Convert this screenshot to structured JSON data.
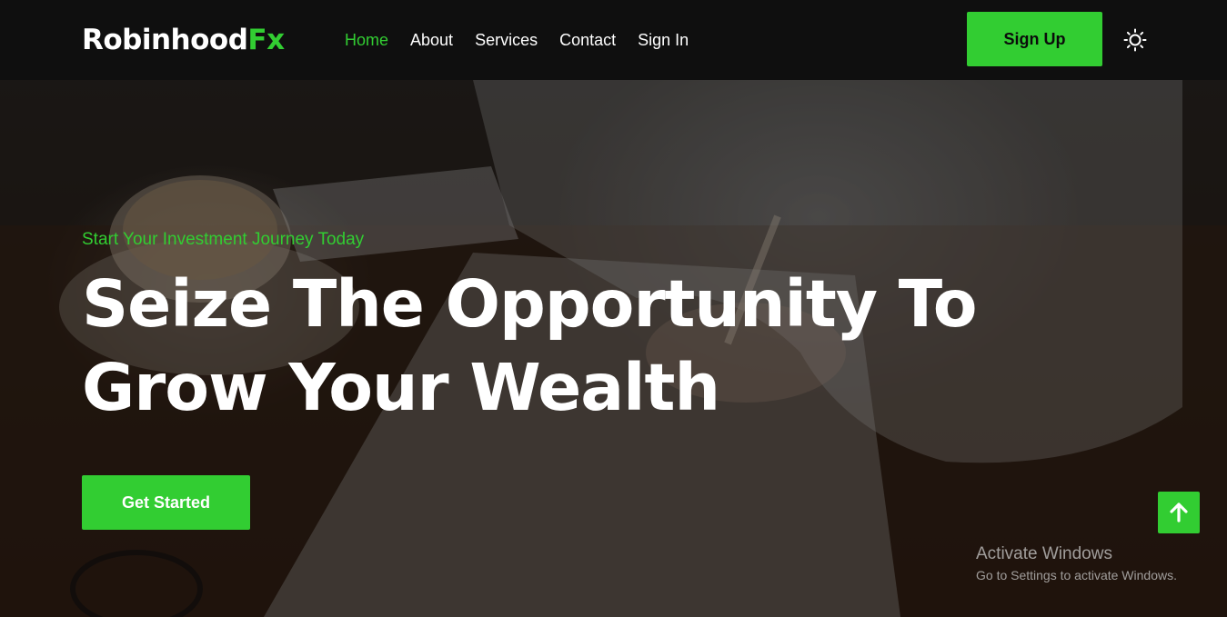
{
  "brand": {
    "name_main": "Robinhood",
    "name_accent": "Fx"
  },
  "nav": {
    "items": [
      {
        "label": "Home",
        "active": true
      },
      {
        "label": "About",
        "active": false
      },
      {
        "label": "Services",
        "active": false
      },
      {
        "label": "Contact",
        "active": false
      },
      {
        "label": "Sign In",
        "active": false
      }
    ],
    "signup_label": "Sign Up",
    "theme_icon": "sun-icon"
  },
  "hero": {
    "kicker": "Start Your Investment Journey Today",
    "title_line1": "Seize The Opportunity To",
    "title_line2": "Grow Your Wealth",
    "cta_label": "Get Started"
  },
  "back_to_top_icon": "arrow-up-icon",
  "watermark": {
    "title": "Activate Windows",
    "subtitle": "Go to Settings to activate Windows."
  },
  "colors": {
    "accent": "#32cd32",
    "navbar_bg": "#0f0f0f",
    "text": "#ffffff"
  }
}
